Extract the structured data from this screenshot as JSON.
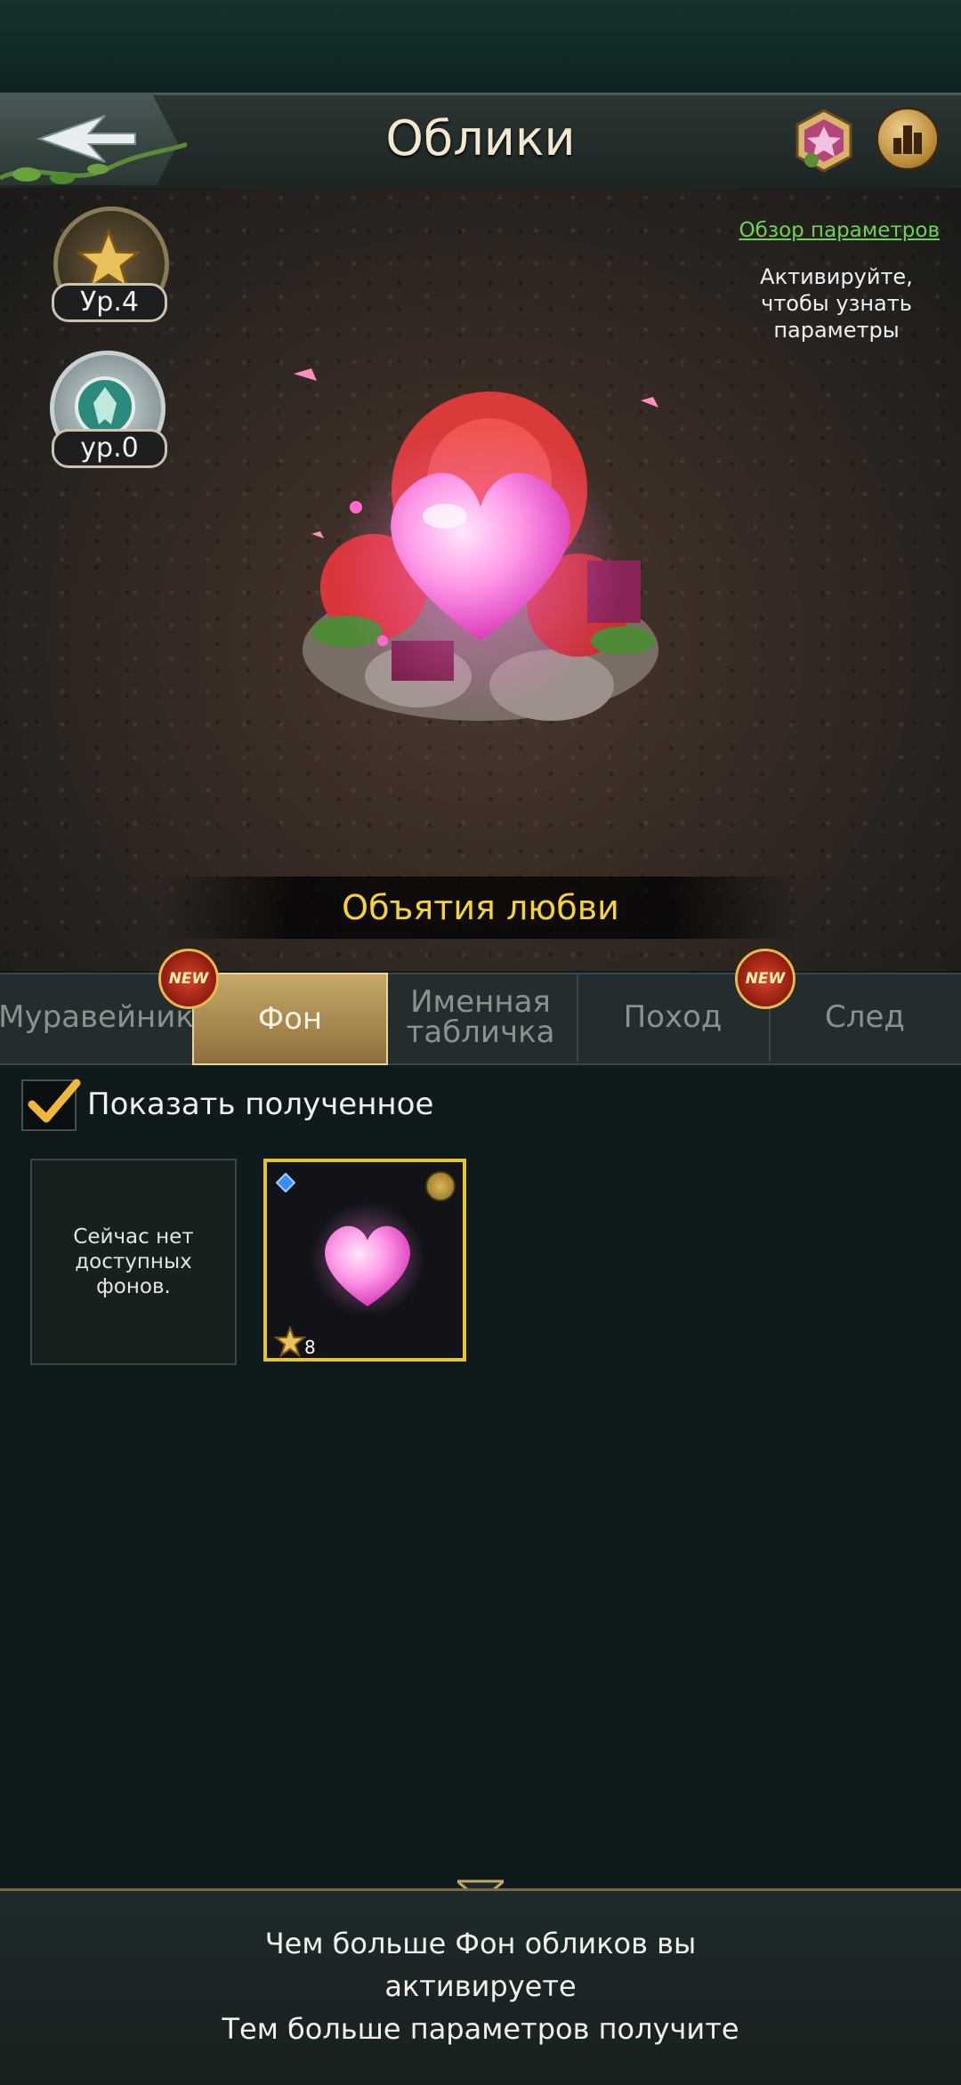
{
  "header": {
    "title": "Облики"
  },
  "profile": {
    "star_level": "Ур.4",
    "shield_level": "ур.0"
  },
  "info": {
    "overview_link": "Обзор параметров",
    "overview_note": "Активируйте, чтобы узнать параметры"
  },
  "preview": {
    "skin_name": "Объятия любви"
  },
  "tabs": [
    {
      "label": "Муравейник",
      "new": true
    },
    {
      "label": "Фон",
      "active": true
    },
    {
      "label": "Именная табличка"
    },
    {
      "label": "Поход",
      "new": true
    },
    {
      "label": "След"
    }
  ],
  "new_badge": "NEW",
  "filter": {
    "show_obtained_label": "Показать полученное",
    "checked": true
  },
  "grid": {
    "empty_text": "Сейчас нет доступных фонов.",
    "items": [
      {
        "star_count": "8",
        "selected": true
      }
    ]
  },
  "footer": {
    "line1": "Чем больше Фон обликов вы",
    "line2": "активируете",
    "line3": "Тем больше параметров получите"
  },
  "colors": {
    "accent_gold": "#e3c332",
    "link_green": "#6fd05a",
    "skin_name_yellow": "#f5d33b",
    "heart_pink": "#ff7ae0"
  }
}
